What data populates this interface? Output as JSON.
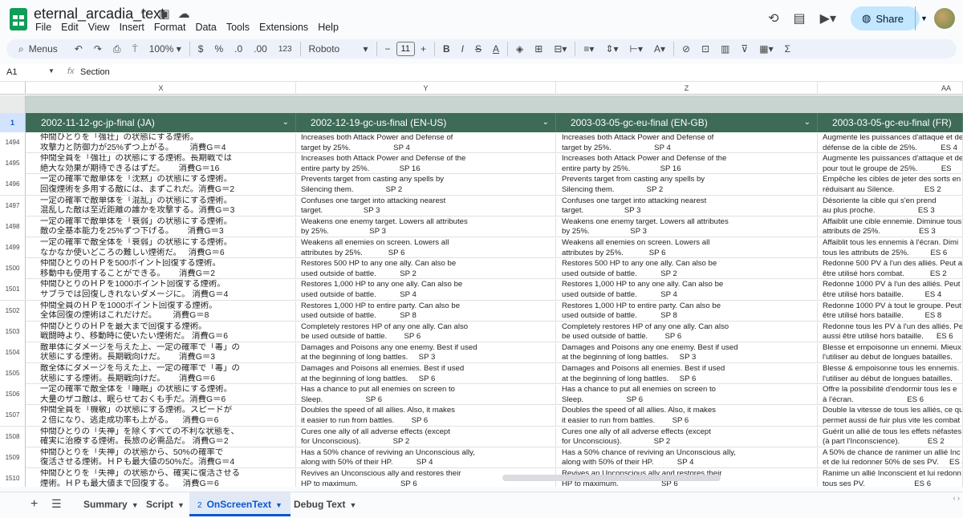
{
  "doc": {
    "title": "eternal_arcadia_text"
  },
  "menu": [
    "File",
    "Edit",
    "View",
    "Insert",
    "Format",
    "Data",
    "Tools",
    "Extensions",
    "Help"
  ],
  "share_label": "Share",
  "toolbar": {
    "menus_label": "Menus",
    "zoom": "100%",
    "currency": "$",
    "percent": "%",
    "dec_less": ".0",
    "dec_more": ".00",
    "format_123": "123",
    "font": "Roboto",
    "font_size": "11"
  },
  "formula": {
    "cell_ref": "A1",
    "fx": "fx",
    "value": "Section"
  },
  "columns": {
    "x": "X",
    "y": "Y",
    "z": "Z",
    "aa": "AA"
  },
  "header_row_num": "1",
  "headers": [
    "2002-11-12-gc-jp-final (JA)",
    "2002-12-19-gc-us-final (EN-US)",
    "2003-03-05-gc-eu-final (EN-GB)",
    "2003-03-05-gc-eu-final (FR)"
  ],
  "rows": [
    {
      "n": "1494",
      "ja": "仲間ひとりを「強壮」の状態にする煙術。\n攻撃力と防御力が25%ずつ上がる。       消費G＝4",
      "us": "Increases both Attack Power and Defense of\ntarget by 25%.                    SP 4",
      "gb": "Increases both Attack Power and Defense of\ntarget by 25%.                    SP 4",
      "fr": "Augmente les puissances d'attaque et de\ndéfense de la cible de 25%.           ES 4"
    },
    {
      "n": "1495",
      "ja": "仲間全員を「強壮」の状態にする煙術。長期戦では\n絶大な効果が期待できるはずだ。      消費G＝16",
      "us": "Increases both Attack Power and Defense of the\nentire party by 25%.              SP 16",
      "gb": "Increases both Attack Power and Defense of the\nentire party by 25%.              SP 16",
      "fr": "Augmente les puissances d'attaque et de\npour tout le groupe de 25%.           ES"
    },
    {
      "n": "1496",
      "ja": "一定の確率で敵単体を「沈黙」の状態にする煙術。\n回復煙術を多用する敵には、まずこれだ。消費G＝2",
      "us": "Prevents target from casting any spells by\nSilencing them.               SP 2",
      "gb": "Prevents target from casting any spells by\nSilencing them.               SP 2",
      "fr": "Empêche les cibles de jeter des sorts en\nréduisant au Silence.              ES 2"
    },
    {
      "n": "1497",
      "ja": "一定の確率で敵単体を「混乱」の状態にする煙術。\n混乱した敵は至近距離の誰かを攻撃する。消費G＝3",
      "us": "Confuses one target into attacking nearest\ntarget.                   SP 3",
      "gb": "Confuses one target into attacking nearest\ntarget.                   SP 3",
      "fr": "Désoriente la cible qui s'en prend\nau plus proche.                    ES 3"
    },
    {
      "n": "1498",
      "ja": "一定の確率で敵単体を「衰弱」の状態にする煙術。\n敵の全基本能力を25%ずつ下げる。      消費G＝3",
      "us": "Weakens one enemy target. Lowers all attributes\nby 25%.                   SP 3",
      "gb": "Weakens one enemy target. Lowers all attributes\nby 25%.                   SP 3",
      "fr": "Affaiblit une cible ennemie. Diminue tous\nattributs de 25%.                  ES 3"
    },
    {
      "n": "1499",
      "ja": "一定の確率で敵全体を「衰弱」の状態にする煙術。\nなかなか使いどころの難しい煙術だ。   消費G＝6",
      "us": "Weakens all enemies on screen. Lowers all\nattributes by 25%.            SP 6",
      "gb": "Weakens all enemies on screen. Lowers all\nattributes by 25%.            SP 6",
      "fr": "Affaiblit tous les ennemis à l'écran. Dimi\ntous les attributs de 25%.          ES 6"
    },
    {
      "n": "1500",
      "ja": "仲間ひとりのＨＰを500ポイント回復する煙術。\n移動中も使用することができる。      消費G＝2",
      "us": "Restores 500 HP to any one ally. Can also be\nused outside of battle.           SP 2",
      "gb": "Restores 500 HP to any one ally. Can also be\nused outside of battle.           SP 2",
      "fr": "Redonne 500 PV à l'un des alliés. Peut a\nêtre utilisé hors combat.            ES 2"
    },
    {
      "n": "1501",
      "ja": "仲間ひとりのＨＰを1000ポイント回復する煙術。\nサブラでは回復しきれないダメージに。 消費G＝4",
      "us": "Restores 1,000 HP to any one ally. Can also be\nused outside of battle.           SP 4",
      "gb": "Restores 1,000 HP to any one ally. Can also be\nused outside of battle.           SP 4",
      "fr": "Redonne 1000 PV à l'un des alliés. Peut\nêtre utilisé hors bataille.          ES 4"
    },
    {
      "n": "1502",
      "ja": "仲間全員のＨＰを1000ポイント回復する煙術。\n全体回復の煙術はこれだけだ。       消費G＝8",
      "us": "Restores 1,000 HP to entire party. Can also be\nused outside of battle.           SP 8",
      "gb": "Restores 1,000 HP to entire party. Can also be\nused outside of battle.           SP 8",
      "fr": "Redonne 1000 PV à tout le groupe. Peut\nêtre utilisé hors bataille.          ES 8"
    },
    {
      "n": "1503",
      "ja": "仲間ひとりのＨＰを最大まで回復する煙術。\n戦闘時より、移動時に使いたい煙術だ。 消費G＝6",
      "us": "Completely restores HP of any one ally. Can also\nbe used outside of battle.        SP 6",
      "gb": "Completely restores HP of any one ally. Can also\nbe used outside of battle.        SP 6",
      "fr": "Redonne tous les PV à l'un des alliés. Pe\naussi être utilisé hors bataille.      ES 6"
    },
    {
      "n": "1504",
      "ja": "敵単体にダメージを与えた上、一定の確率で「毒」の\n状態にする煙術。長期戦向けだ。      消費G＝3",
      "us": "Damages and Poisons any one enemy. Best if used\nat the beginning of long battles.     SP 3",
      "gb": "Damages and Poisons any one enemy. Best if used\nat the beginning of long battles.     SP 3",
      "fr": "Blesse et empoisonne un ennemi. Mieux\nl'utiliser au début de longues batailles."
    },
    {
      "n": "1505",
      "ja": "敵全体にダメージを与えた上、一定の確率で「毒」の\n状態にする煙術。長期戦向けだ。      消費G＝6",
      "us": "Damages and Poisons all enemies. Best if used\nat the beginning of long battles.     SP 6",
      "gb": "Damages and Poisons all enemies. Best if used\nat the beginning of long battles.     SP 6",
      "fr": "Blesse & empoisonne tous les ennemis.\nl'utiliser au début de longues batailles."
    },
    {
      "n": "1506",
      "ja": "一定の確率で敵全体を「睡眠」の状態にする煙術。\n大量のザコ敵は、眠らせておくも手だ。消費G＝6",
      "us": "Has a chance to put all enemies on screen to\nSleep.                    SP 6",
      "gb": "Has a chance to put all enemies on screen to\nSleep.                    SP 6",
      "fr": "Offre la possibilité d'endormir tous les e\nà l'écran.                         ES 6"
    },
    {
      "n": "1507",
      "ja": "仲間全員を「機敏」の状態にする煙術。スピードが\n２倍になり、逃走成功率も上がる。    消費G＝6",
      "us": "Doubles the speed of all allies. Also, it makes\nit easier to run from battles.        SP 6",
      "gb": "Doubles the speed of all allies. Also, it makes\nit easier to run from battles.        SP 6",
      "fr": "Double la vitesse de tous les alliés, ce qu\npermet aussi de fuir plus vite les combat"
    },
    {
      "n": "1508",
      "ja": "仲間ひとりの「失神」を除くすべての不利な状態を、\n確実に治療する煙術。長旅の必需品だ。 消費G＝2",
      "us": "Cures one ally of all adverse effects (except\nfor Unconscious).               SP 2",
      "gb": "Cures one ally of all adverse effects (except\nfor Unconscious).               SP 2",
      "fr": "Guérit un allié de tous les effets néfastes\n(à part l'Inconscience).             ES 2"
    },
    {
      "n": "1509",
      "ja": "仲間ひとりを「失神」の状態から、50%の確率で\n復活させる煙術。ＨＰも最大値の50%だ。消費G＝4",
      "us": "Has a 50% chance of reviving an Unconscious ally,\nalong with 50% of their HP.           SP 4",
      "gb": "Has a 50% chance of reviving an Unconscious ally,\nalong with 50% of their HP.           SP 4",
      "fr": "A 50% de chance de ranimer un allié Inc\net de lui redonner 50% de ses PV.     ES 4"
    },
    {
      "n": "1510",
      "ja": "仲間ひとりを「失神」の状態から、確実に復活させる\n煙術。ＨＰも最大値まで回復する。    消費G＝6",
      "us": "Revives an Unconscious ally and restores their\nHP to maximum.                    SP 6",
      "gb": "Revives an Unconscious ally and restores their\nHP to maximum.                    SP 6",
      "fr": "Ranime un allié Inconscient et lui redonn\ntous ses PV.                       ES 6"
    }
  ],
  "sheets": [
    {
      "label": "Summary"
    },
    {
      "label": "Script"
    },
    {
      "label": "OnScreenText",
      "num": "2",
      "active": true
    },
    {
      "label": "Debug Text"
    }
  ]
}
